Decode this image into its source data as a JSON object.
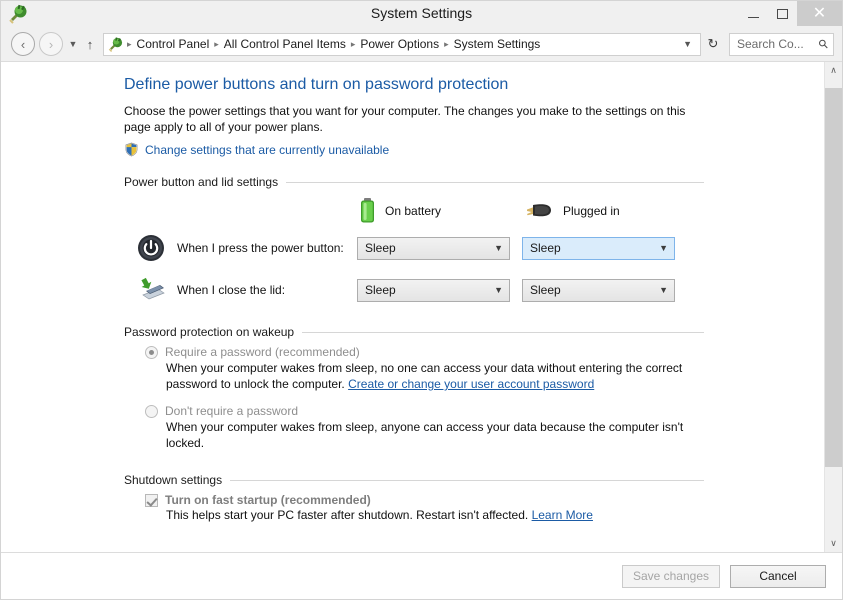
{
  "window": {
    "title": "System Settings",
    "icon": "power-plug-icon",
    "controls": {
      "minimize": "minimize-icon",
      "maximize": "maximize-icon",
      "close": "✕"
    }
  },
  "navbar": {
    "back": "back-icon",
    "forward": "forward-icon",
    "recent_dropdown": "chevron-down-icon",
    "up": "up-arrow-icon",
    "breadcrumb_icon": "power-plug-icon",
    "breadcrumbs": [
      "Control Panel",
      "All Control Panel Items",
      "Power Options",
      "System Settings"
    ],
    "separator": "▸",
    "address_chevron": "chevron-down-icon",
    "refresh": "↻",
    "search": {
      "placeholder": "Search Co...",
      "icon": "search-icon"
    }
  },
  "page": {
    "title": "Define power buttons and turn on password protection",
    "description": "Choose the power settings that you want for your computer. The changes you make to the settings on this page apply to all of your power plans.",
    "uac_link": "Change settings that are currently unavailable",
    "uac_icon": "uac-shield-icon"
  },
  "power_section": {
    "heading": "Power button and lid settings",
    "columns": [
      {
        "label": "On battery",
        "icon": "battery-icon"
      },
      {
        "label": "Plugged in",
        "icon": "power-plug-icon"
      }
    ],
    "rows": [
      {
        "icon": "power-button-icon",
        "label": "When I press the power button:",
        "on_battery": "Sleep",
        "plugged_in": "Sleep",
        "focused_cell": "plugged_in"
      },
      {
        "icon": "laptop-lid-icon",
        "label": "When I close the lid:",
        "on_battery": "Sleep",
        "plugged_in": "Sleep",
        "focused_cell": null
      }
    ],
    "dropdown_arrow": "∨"
  },
  "password_section": {
    "heading": "Password protection on wakeup",
    "options": [
      {
        "label": "Require a password (recommended)",
        "selected": true,
        "description_before_link": "When your computer wakes from sleep, no one can access your data without entering the correct password to unlock the computer. ",
        "link": "Create or change your user account password"
      },
      {
        "label": "Don't require a password",
        "selected": false,
        "description_before_link": "When your computer wakes from sleep, anyone can access your data because the computer isn't locked.",
        "link": ""
      }
    ]
  },
  "shutdown_section": {
    "heading": "Shutdown settings",
    "checkbox": {
      "label": "Turn on fast startup (recommended)",
      "checked": true,
      "disabled": true,
      "description": "This helps start your PC faster after shutdown. Restart isn't affected. ",
      "link": "Learn More"
    }
  },
  "footer": {
    "save_label": "Save changes",
    "save_disabled": true,
    "cancel_label": "Cancel"
  },
  "scrollbar": {
    "up_arrow": "∧",
    "down_arrow": "∨"
  },
  "colors": {
    "heading_blue": "#1b5ba5",
    "link_blue": "#1b5ba5",
    "focus_blue": "#daecfb",
    "battery_green": "#5aba3c"
  }
}
